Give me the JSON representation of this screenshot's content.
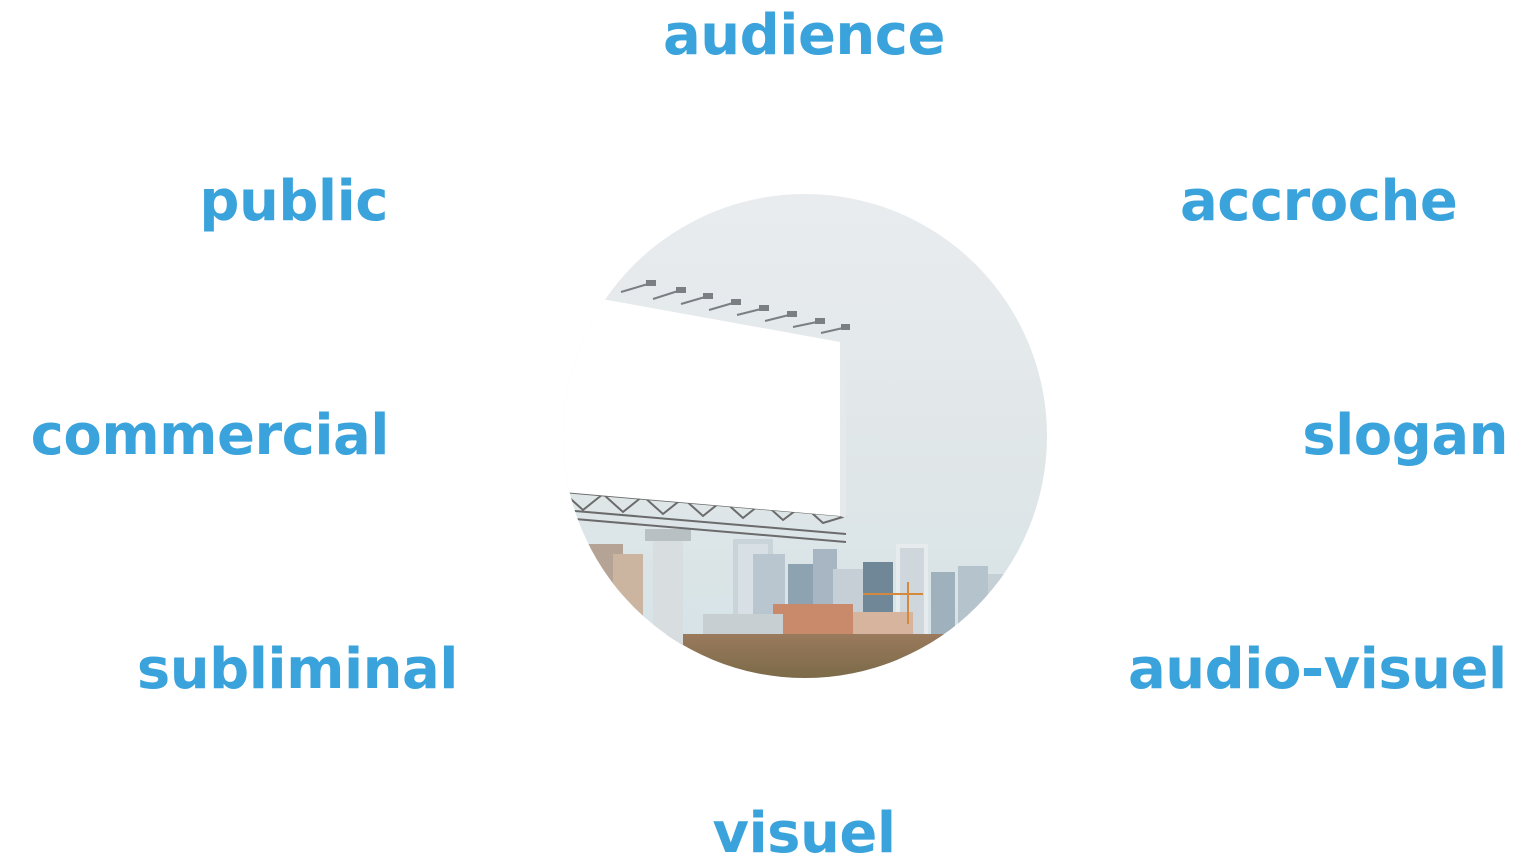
{
  "words": {
    "top": "audience",
    "upper_left": "public",
    "upper_right": "accroche",
    "middle_left": "commercial",
    "middle_right": "slogan",
    "lower_left": "subliminal",
    "lower_right": "audio-visuel",
    "bottom": "visuel"
  },
  "colors": {
    "accent": "#3aa3dc",
    "background": "#ffffff"
  },
  "image": {
    "subject": "blank billboard in front of city skyline, cropped in a circle"
  }
}
